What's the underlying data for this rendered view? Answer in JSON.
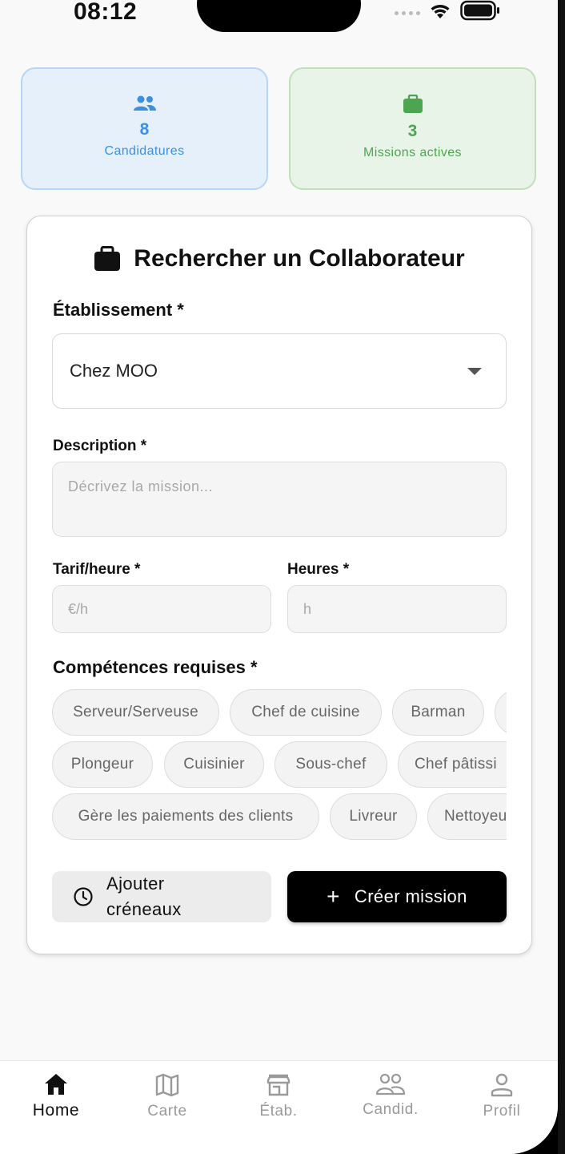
{
  "status_bar": {
    "time": "08:12"
  },
  "stats": [
    {
      "value": "8",
      "label": "Candidatures",
      "icon": "people-icon",
      "color": "#3d8fe0"
    },
    {
      "value": "3",
      "label": "Missions actives",
      "icon": "briefcase-icon",
      "color": "#4ca650"
    }
  ],
  "form": {
    "title": "Rechercher un Collaborateur",
    "establishment_label": "Établissement *",
    "establishment_value": "Chez MOO",
    "description_label": "Description *",
    "description_placeholder": "Décrivez la mission...",
    "rate_label": "Tarif/heure *",
    "rate_placeholder": "€/h",
    "hours_label": "Heures *",
    "hours_placeholder": "h",
    "skills_label": "Compétences requises *",
    "skills_row1": [
      "Serveur/Serveuse",
      "Chef de cuisine",
      "Barman"
    ],
    "skills_row2": [
      "Plongeur",
      "Cuisinier",
      "Sous-chef",
      "Chef pâtissi"
    ],
    "skills_row3": [
      "Gère les paiements des clients",
      "Livreur",
      "Nettoyeu"
    ],
    "add_slots_line1": "Ajouter",
    "add_slots_line2": "créneaux",
    "create_label": "Créer mission"
  },
  "nav": [
    {
      "label": "Home",
      "icon": "home-icon",
      "active": true
    },
    {
      "label": "Carte",
      "icon": "map-icon"
    },
    {
      "label": "Étab.",
      "icon": "store-icon"
    },
    {
      "label": "Candid.",
      "icon": "group-icon"
    },
    {
      "label": "Profil",
      "icon": "person-icon"
    }
  ],
  "colors": {
    "blue": "#3d8fe0",
    "green": "#4ca650",
    "primary": "#000000"
  }
}
